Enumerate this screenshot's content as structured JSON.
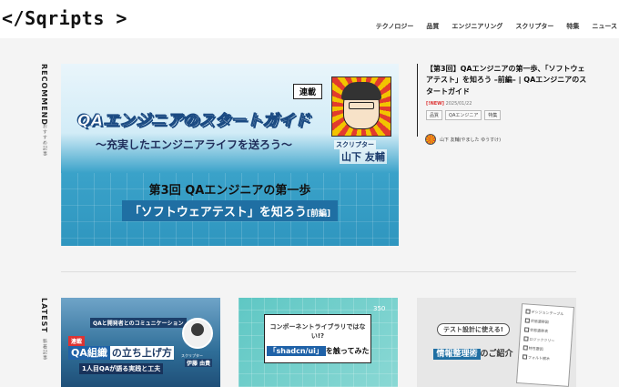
{
  "header": {
    "logo": "</Sqripts >",
    "nav": [
      "テクノロジー",
      "品質",
      "エンジニアリング",
      "スクリプター",
      "特集",
      "ニュース"
    ]
  },
  "recommend": {
    "label": "RECOMMEND",
    "sublabel": "おすすめ記事",
    "banner": {
      "tag": "連載",
      "title": "QAエンジニアのスタートガイド",
      "subtitle": "〜充実したエンジニアライフを送ろう〜",
      "role": "スクリプター",
      "author": "山下 友輔",
      "series": "第3回 QAエンジニアの第一歩",
      "part": "「ソフトウェアテスト」を知ろう",
      "part_suffix": "[前編]"
    },
    "article": {
      "title": "【第3回】QAエンジニアの第一歩、「ソフトウェアテスト」を知ろう –前編– | QAエンジニアのスタートガイド",
      "new_badge": "[!NEW]",
      "date": "2025/01/22",
      "tags": [
        "品質",
        "QAエンジニア",
        "特集"
      ],
      "author": "山下 友輔(やました ゆうすけ)"
    }
  },
  "latest": {
    "label": "LATEST",
    "sublabel": "新着記事",
    "cards": [
      {
        "top": "QAと開発者とのコミュニケーション",
        "tag": "連載",
        "title_highlight": "QA組織",
        "title_rest": "の立ち上げ方",
        "sub": "1人目QAが語る実践と工夫",
        "role": "スクリプター",
        "name": "伊藤 由貴"
      },
      {
        "number": "350",
        "question": "コンポーネントライブラリではない!?",
        "name_highlight": "「shadcn/ui」",
        "name_rest": "を触ってみた"
      },
      {
        "pill": "テスト設計に使える!",
        "title_highlight": "情報整理術",
        "title_rest": "のご紹介",
        "list": [
          "デシジョンテーブル",
          "状態遷移図",
          "状態遷移表",
          "ロジックツリー",
          "特性要因",
          "フォルト樹木"
        ]
      }
    ]
  }
}
